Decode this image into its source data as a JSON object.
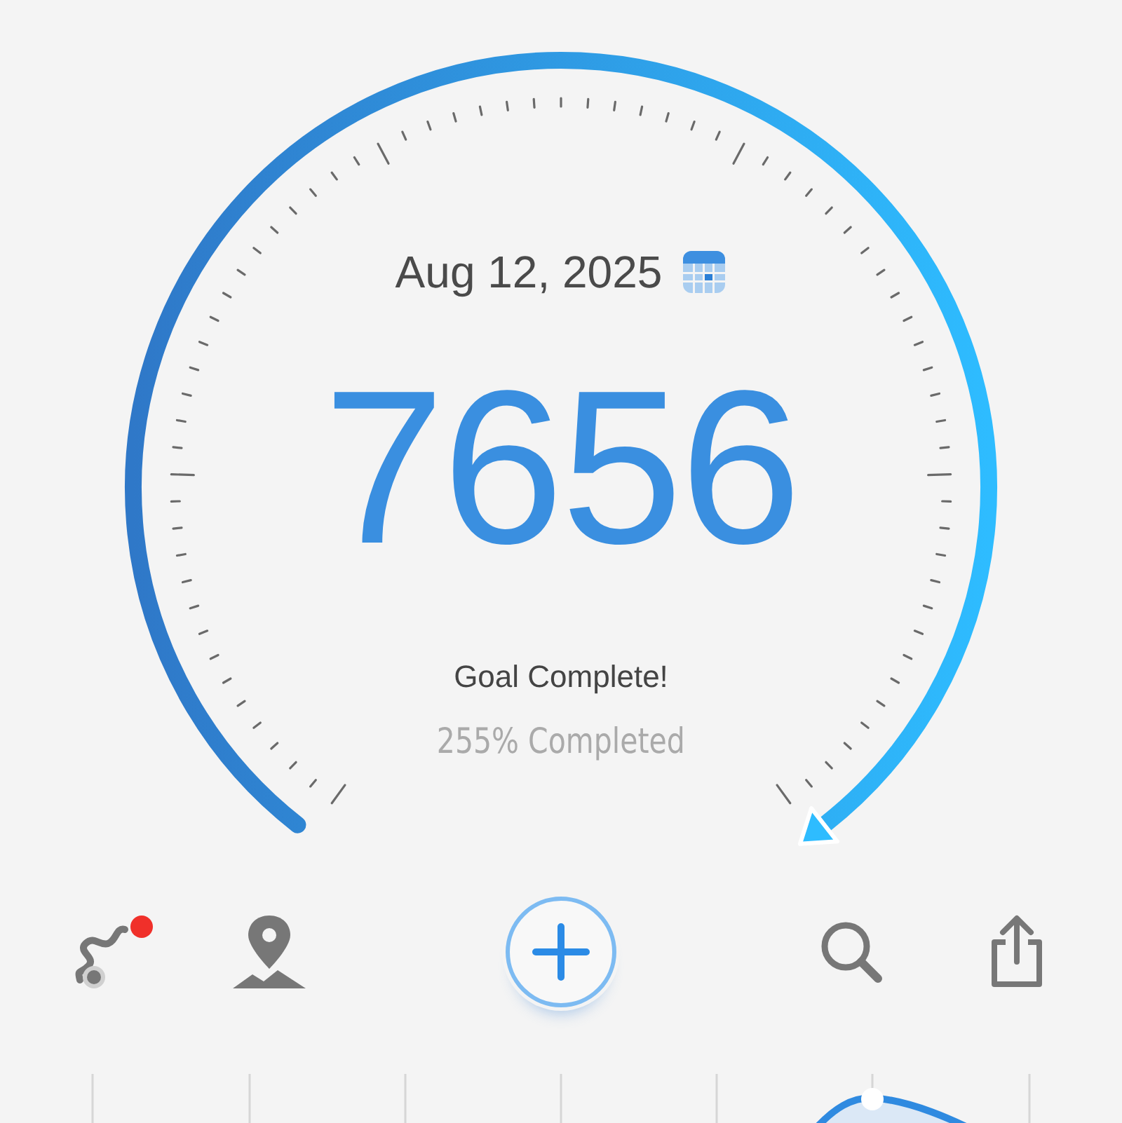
{
  "date": "Aug 12, 2025",
  "steps": "7656",
  "goal_status": "Goal Complete!",
  "progress_text": "255% Completed",
  "toolbar": [
    {
      "kind": "route",
      "badge": true
    },
    {
      "kind": "map",
      "badge": false
    },
    {
      "kind": "add",
      "badge": false
    },
    {
      "kind": "search",
      "badge": false
    },
    {
      "kind": "share",
      "badge": false
    }
  ]
}
